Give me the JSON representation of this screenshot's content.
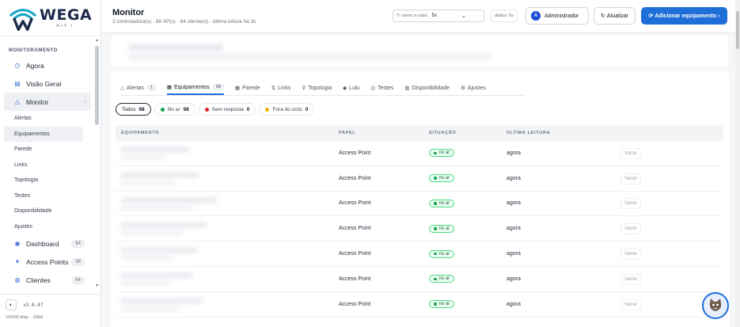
{
  "brand": {
    "name": "WEGA",
    "sub": "A+F I"
  },
  "sidebar": {
    "section": "MONITORAMENTO",
    "items": [
      {
        "label": "Agora",
        "icon": "clock-icon"
      },
      {
        "label": "Visão Geral",
        "icon": "overview-icon"
      },
      {
        "label": "Monitor",
        "icon": "monitor-icon"
      }
    ],
    "monitor_sub": [
      "Alertas",
      "Equipamentos",
      "Parede",
      "Links",
      "Topologia",
      "Testes",
      "Disponibilidade",
      "Ajustes"
    ],
    "bottom_items": [
      {
        "label": "Dashboard",
        "count": "64"
      },
      {
        "label": "Access Points",
        "count": "88"
      },
      {
        "label": "Clientes",
        "count": "64"
      }
    ],
    "version": "v2.0.47",
    "footnote": "10/500 disp. · 33bd"
  },
  "header": {
    "title": "Monitor",
    "subtitle": "3 controladora(s) · 88 AP(s) · 64 cliente(s) · última leitura há 3s",
    "refresh_label": "varrer a cada",
    "refresh_value": "5s",
    "data_age": "dados: 5s",
    "admin_initial": "A",
    "admin_label": "Administrador",
    "update_label": "Atualizar",
    "add_label": "Adicionar equipamento"
  },
  "tabs": [
    {
      "label": "Alertas",
      "icon": "△",
      "badge": "1"
    },
    {
      "label": "Equipamentos",
      "icon": "▦",
      "badge": "98",
      "active": true
    },
    {
      "label": "Parede",
      "icon": "▦"
    },
    {
      "label": "Links",
      "icon": "⇅"
    },
    {
      "label": "Topologia",
      "icon": "⚲"
    },
    {
      "label": "Lulu",
      "icon": "◆"
    },
    {
      "label": "Testes",
      "icon": "◎"
    },
    {
      "label": "Disponibilidade",
      "icon": "▥"
    },
    {
      "label": "Ajustes",
      "icon": "⚙"
    }
  ],
  "filters": [
    {
      "label": "Todos",
      "count": "98",
      "color": ""
    },
    {
      "label": "No ar",
      "count": "98",
      "color": "#16a34a"
    },
    {
      "label": "Sem resposta",
      "count": "0",
      "color": "#dc2626"
    },
    {
      "label": "Fora do ciclo",
      "count": "0",
      "color": "#eab308"
    }
  ],
  "table": {
    "columns": [
      "EQUIPAMENTO",
      "PAPEL",
      "SITUAÇÃO",
      "ÚLTIMA LEITURA"
    ],
    "rows": [
      {
        "role": "Access Point",
        "status": "no ar",
        "last": "agora",
        "action": "Varrer"
      },
      {
        "role": "Access Point",
        "status": "no ar",
        "last": "agora",
        "action": "Varrer"
      },
      {
        "role": "Access Point",
        "status": "no ar",
        "last": "agora",
        "action": "Varrer"
      },
      {
        "role": "Access Point",
        "status": "no ar",
        "last": "agora",
        "action": "Varrer"
      },
      {
        "role": "Access Point",
        "status": "no ar",
        "last": "agora",
        "action": "Varrer"
      },
      {
        "role": "Access Point",
        "status": "no ar",
        "last": "agora",
        "action": "Varrer"
      },
      {
        "role": "Access Point",
        "status": "no ar",
        "last": "agora",
        "action": "Varrer"
      }
    ]
  },
  "colors": {
    "accent": "#1f6fd8",
    "ok": "#16a34a",
    "brand_dark": "#1e2a4a"
  }
}
